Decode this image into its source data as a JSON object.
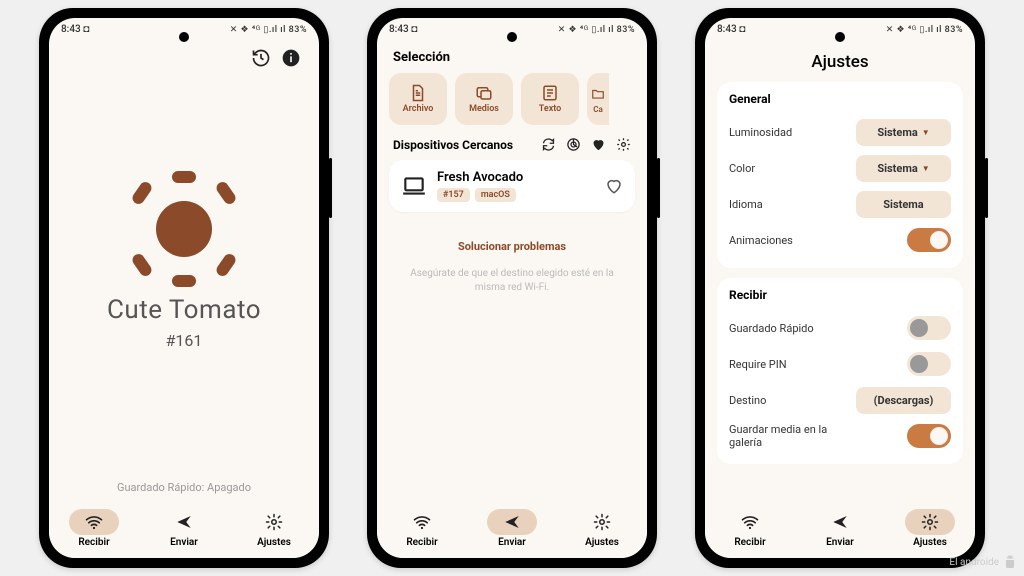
{
  "status": {
    "time": "8:43",
    "timeIcon": "◘",
    "battery": "83%",
    "signal": "⁴ᴳ ▯.ıl ıl"
  },
  "phone1": {
    "name": "Cute Tomato",
    "hash": "#161",
    "quicksave": "Guardado Rápido: Apagado"
  },
  "phone2": {
    "selection": "Selección",
    "chips": {
      "file": "Archivo",
      "media": "Medios",
      "text": "Texto",
      "folder": "Ca"
    },
    "nearby": "Dispositivos Cercanos",
    "device": {
      "name": "Fresh Avocado",
      "hash": "#157",
      "os": "macOS"
    },
    "troubleshoot": "Solucionar problemas",
    "hint": "Asegúrate de que el destino elegido esté en la misma red Wi-Fi."
  },
  "phone3": {
    "title": "Ajustes",
    "general": {
      "heading": "General",
      "brightness": "Luminosidad",
      "color": "Color",
      "language": "Idioma",
      "animations": "Animaciones",
      "system": "Sistema"
    },
    "receive": {
      "heading": "Recibir",
      "quicksave": "Guardado Rápido",
      "pin": "Require PIN",
      "destination": "Destino",
      "destination_value": "(Descargas)",
      "savemedia": "Guardar media en la galería"
    }
  },
  "nav": {
    "receive": "Recibir",
    "send": "Enviar",
    "settings": "Ajustes"
  },
  "watermark": "El androide"
}
